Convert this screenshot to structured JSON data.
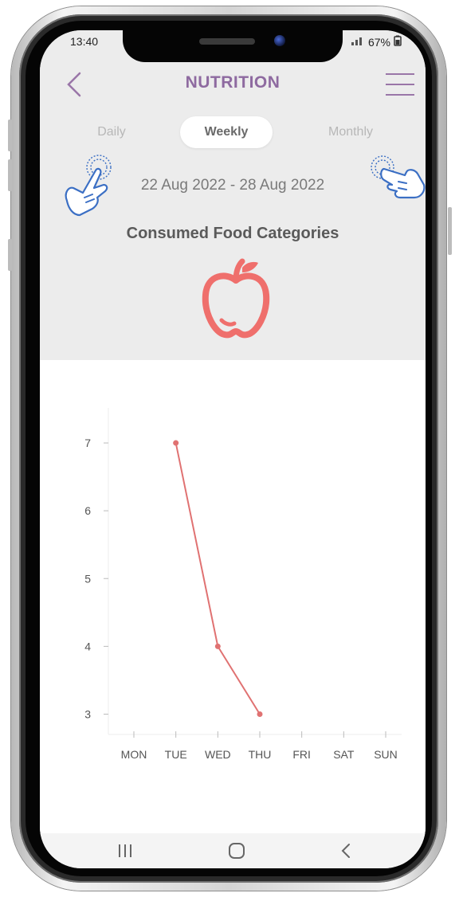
{
  "status_bar": {
    "time": "13:40",
    "battery": "67%"
  },
  "header": {
    "title": "NUTRITION"
  },
  "tabs": [
    {
      "label": "Daily",
      "active": false
    },
    {
      "label": "Weekly",
      "active": true
    },
    {
      "label": "Monthly",
      "active": false
    }
  ],
  "date_range": "22 Aug 2022 - 28 Aug 2022",
  "section_title": "Consumed Food Categories",
  "icons": {
    "back": "chevron-left-icon",
    "menu": "hamburger-menu-icon",
    "swipe_left": "pointing-hand-icon",
    "swipe_right": "pointing-hand-icon",
    "category": "apple-icon",
    "nav_recents": "recents-icon",
    "nav_home": "home-icon",
    "nav_back": "back-icon"
  },
  "colors": {
    "accent": "#8e6aa0",
    "series": "#e07272",
    "apple": "#ef6f6c",
    "hand": "#3b6fc4"
  },
  "chart_data": {
    "type": "line",
    "categories": [
      "MON",
      "TUE",
      "WED",
      "THU",
      "FRI",
      "SAT",
      "SUN"
    ],
    "values": [
      null,
      7,
      4,
      3,
      null,
      null,
      null
    ],
    "ylim": [
      2.7,
      7.4
    ],
    "yticks": [
      3,
      4,
      5,
      6,
      7
    ],
    "grid": false
  }
}
